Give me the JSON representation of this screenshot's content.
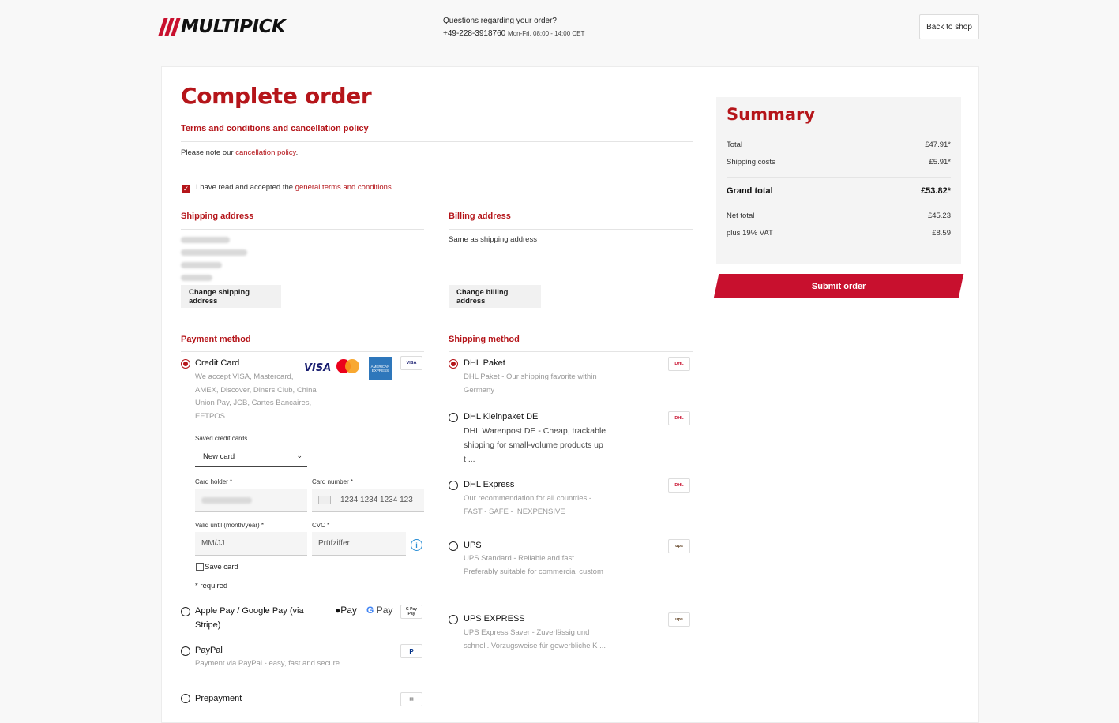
{
  "header": {
    "logo_text": "MULTIPICK",
    "support_question": "Questions regarding your order?",
    "support_phone": "+49-228-3918760",
    "support_hours": "Mon-Fri, 08:00 - 14:00 CET",
    "back_label": "Back to shop"
  },
  "page": {
    "title": "Complete order"
  },
  "terms": {
    "heading": "Terms and conditions and cancellation policy",
    "note_prefix": "Please note our",
    "note_link": "cancellation policy",
    "note_suffix": ".",
    "accept_prefix": "I have read and accepted the",
    "accept_link": "general terms and conditions",
    "accept_suffix": ".",
    "accepted": true
  },
  "shipping_address": {
    "heading": "Shipping address",
    "change_label": "Change shipping address"
  },
  "billing_address": {
    "heading": "Billing address",
    "text": "Same as shipping address",
    "change_label": "Change billing address"
  },
  "payment": {
    "heading": "Payment method",
    "credit_card": {
      "label": "Credit Card",
      "desc_lines": [
        "We accept VISA, Mastercard,",
        "AMEX, Discover, Diners Club, China",
        "Union Pay, JCB, Cartes Bancaires,",
        "EFTPOS"
      ],
      "saved_label": "Saved credit cards",
      "saved_value": "New card",
      "holder_label": "Card holder *",
      "number_label": "Card number *",
      "number_placeholder": "1234 1234 1234 123",
      "valid_label": "Valid until (month/year) *",
      "valid_placeholder": "MM/JJ",
      "cvc_label": "CVC *",
      "cvc_placeholder": "Prüfziffer",
      "save_card_label": "Save card",
      "required_note": "* required",
      "logos": {
        "visa": "VISA",
        "amex": "AMERICAN EXPRESS",
        "visa_badge": "VISA"
      }
    },
    "wallet": {
      "label_line1": "Apple Pay / Google Pay (via",
      "label_line2": "Stripe)",
      "apple": "Pay",
      "google": "Pay",
      "badge_top": "G Pay",
      "badge_bottom": "Pay"
    },
    "paypal": {
      "label": "PayPal",
      "desc": "Payment via PayPal - easy, fast and secure.",
      "badge": "P"
    },
    "prepayment": {
      "label": "Prepayment"
    }
  },
  "shipping": {
    "heading": "Shipping method",
    "options": [
      {
        "label": "DHL Paket",
        "desc_lines": [
          "DHL Paket - Our shipping favorite within",
          "Germany"
        ],
        "badge": "DHL"
      },
      {
        "label": "DHL Kleinpaket DE",
        "desc_lines": [
          "DHL Warenpost DE - Cheap, trackable",
          "shipping for small-volume products up",
          "t ..."
        ],
        "badge": "DHL"
      },
      {
        "label": "DHL Express",
        "desc_lines": [
          "Our recommendation for all countries -",
          "FAST - SAFE - INEXPENSIVE"
        ],
        "badge": "DHL"
      },
      {
        "label": "UPS",
        "desc_lines": [
          "UPS Standard - Reliable and fast.",
          "Preferably suitable for commercial custom",
          "..."
        ],
        "badge": "ups"
      },
      {
        "label": "UPS EXPRESS",
        "desc_lines": [
          "UPS Express Saver - Zuverlässig und",
          "schnell. Vorzugsweise für gewerbliche K ..."
        ],
        "badge": "ups"
      }
    ]
  },
  "summary": {
    "title": "Summary",
    "total_label": "Total",
    "total_value": "£47.91*",
    "shipping_label": "Shipping costs",
    "shipping_value": "£5.91*",
    "grand_label": "Grand total",
    "grand_value": "£53.82*",
    "net_label": "Net total",
    "net_value": "£45.23",
    "vat_label": "plus 19% VAT",
    "vat_value": "£8.59",
    "submit_label": "Submit order"
  },
  "colors": {
    "accent": "#b5151a",
    "button": "#c8102e"
  }
}
